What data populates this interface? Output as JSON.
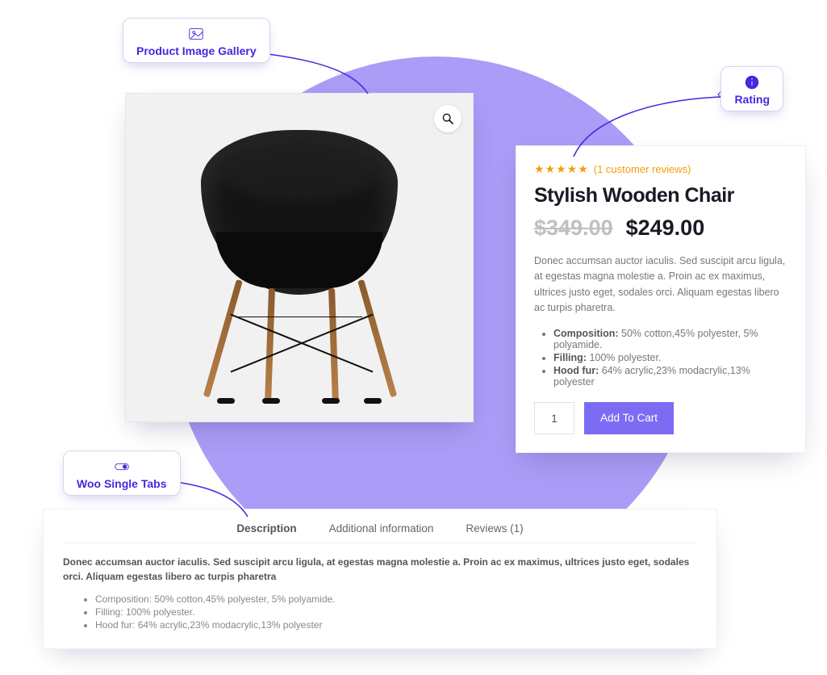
{
  "callouts": {
    "gallery": "Product Image Gallery",
    "rating": "Rating",
    "tabs": "Woo Single Tabs"
  },
  "product": {
    "title": "Stylish Wooden Chair",
    "rating_text": "(1 customer reviews)",
    "price_old": "$349.00",
    "price_new": "$249.00",
    "description": "Donec accumsan auctor iaculis. Sed suscipit arcu ligula, at egestas magna molestie a. Proin ac ex maximus, ultrices justo eget, sodales orci. Aliquam egestas libero ac turpis pharetra.",
    "specs": [
      {
        "label": "Composition:",
        "value": " 50% cotton,45% polyester, 5% polyamide."
      },
      {
        "label": "Filling:",
        "value": " 100% polyester."
      },
      {
        "label": "Hood fur:",
        "value": " 64% acrylic,23% modacrylic,13% polyester"
      }
    ],
    "qty": "1",
    "add_to_cart": "Add To Cart"
  },
  "tabs": {
    "items": [
      "Description",
      "Additional information",
      "Reviews (1)"
    ],
    "content": "Donec accumsan auctor iaculis. Sed suscipit arcu ligula, at egestas magna molestie a. Proin ac ex maximus, ultrices justo eget, sodales orci. Aliquam egestas libero ac turpis pharetra",
    "specs": [
      "Composition: 50% cotton,45% polyester, 5% polyamide.",
      "Filling: 100% polyester.",
      "Hood fur: 64% acrylic,23% modacrylic,13% polyester"
    ]
  }
}
